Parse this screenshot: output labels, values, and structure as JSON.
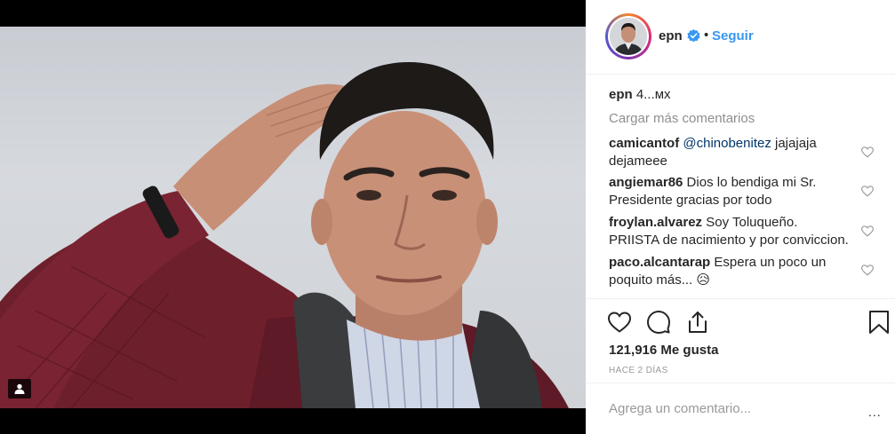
{
  "post": {
    "username": "epn",
    "separator": "•",
    "follow_label": "Seguir"
  },
  "caption": {
    "username": "epn",
    "text": "4...мх"
  },
  "load_more_label": "Cargar más comentarios",
  "comments": [
    {
      "user": "camicantof",
      "mention": "@chinobenitez",
      "text": " jajajaja dejameee"
    },
    {
      "user": "angiemar86",
      "mention": "",
      "text": " Dios lo bendiga mi Sr. Presidente gracias por todo"
    },
    {
      "user": "froylan.alvarez",
      "mention": "",
      "text": " Soy Toluqueño. PRIISTA de nacimiento y por conviccion."
    },
    {
      "user": "paco.alcantarap",
      "mention": "",
      "text": " Espera un poco un poquito más... 😥"
    }
  ],
  "likes": {
    "count": "121,916",
    "label": " Me gusta"
  },
  "timestamp": "HACE 2 DÍAS",
  "add_comment": {
    "placeholder": "Agrega un comentario...",
    "more_label": "..."
  },
  "colors": {
    "link_blue": "#3897f0",
    "mention": "#003569",
    "muted": "#8e8e8e",
    "verified": "#3897f0"
  },
  "icons": [
    "user-tag-icon",
    "verified-badge-icon",
    "heart-icon",
    "comment-icon",
    "share-icon",
    "bookmark-icon",
    "heart-small-icon"
  ]
}
